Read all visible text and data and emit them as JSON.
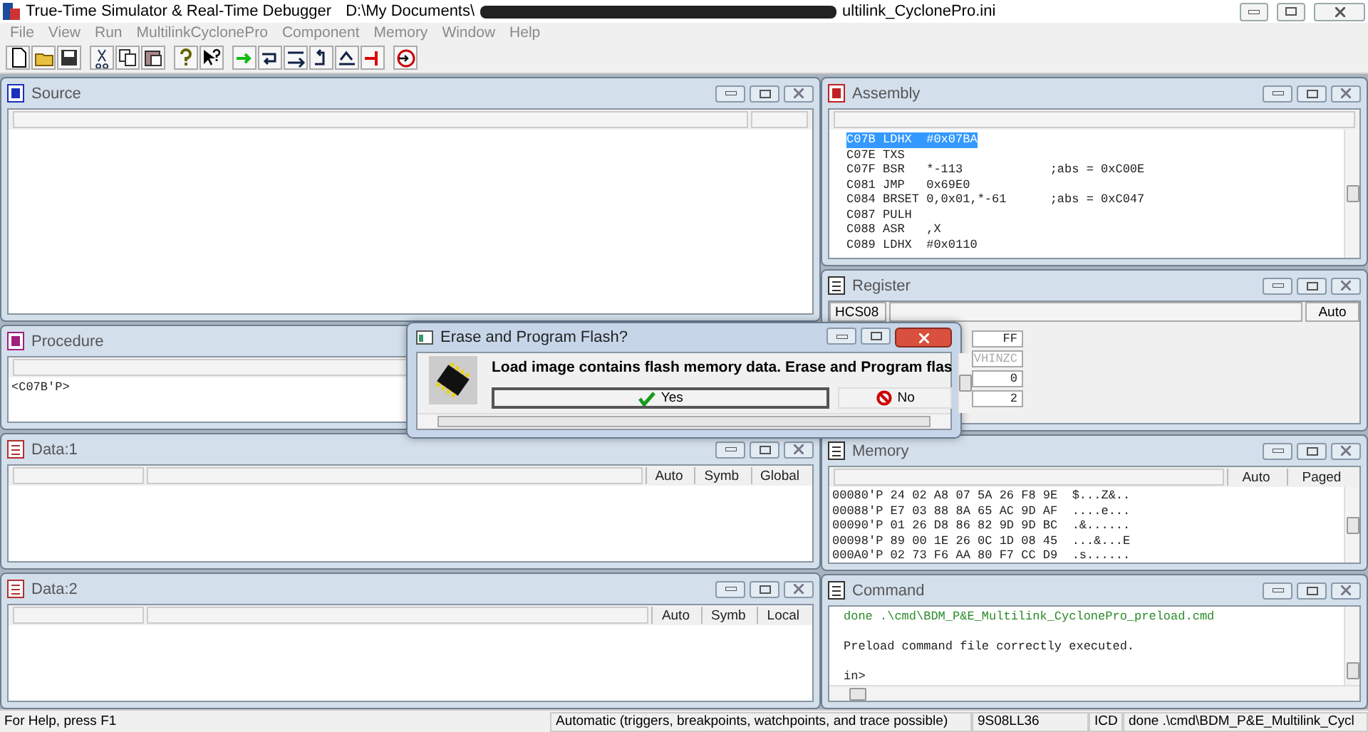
{
  "window": {
    "title": "True-Time Simulator & Real-Time Debugger",
    "path_start": "D:\\My Documents\\",
    "path_end": "ultilink_CyclonePro.ini"
  },
  "menu": [
    "File",
    "View",
    "Run",
    "MultilinkCyclonePro",
    "Component",
    "Memory",
    "Window",
    "Help"
  ],
  "left_panels": [
    {
      "kind": "source",
      "title": "Source"
    },
    {
      "kind": "procedure",
      "title": "Procedure",
      "lines": [
        "<C07B'P>"
      ]
    },
    {
      "kind": "data",
      "title": "Data:1",
      "headers": [
        "Auto",
        "Symb",
        "Global"
      ]
    },
    {
      "kind": "data",
      "title": "Data:2",
      "headers": [
        "Auto",
        "Symb",
        "Local"
      ]
    }
  ],
  "right_panels": [
    {
      "kind": "assembly",
      "title": "Assembly",
      "lines": [
        {
          "addr": "C07B",
          "op": "LDHX",
          "arg": "#0x07BA",
          "selected": true
        },
        {
          "addr": "C07E",
          "op": "TXS",
          "selected": false
        },
        {
          "addr": "C07F",
          "op": "BSR",
          "arg": "*-113",
          "comment": ";abs = 0xC00E",
          "selected": false
        },
        {
          "addr": "C081",
          "op": "JMP",
          "arg": "0x69E0",
          "selected": false
        },
        {
          "addr": "C084",
          "op": "BRSET",
          "arg": "0,0x01,*-61",
          "comment": ";abs = 0xC047",
          "selected": false
        },
        {
          "addr": "C087",
          "op": "PULH",
          "selected": false
        },
        {
          "addr": "C088",
          "op": "ASR",
          "arg": ",X",
          "selected": false
        },
        {
          "addr": "C089",
          "op": "LDHX",
          "arg": "#0x0110",
          "selected": false
        }
      ]
    },
    {
      "kind": "register",
      "title": "Register",
      "cpu": "HCS08",
      "mode": "Auto",
      "fields": [
        {
          "text": "FF",
          "disabled": false
        },
        {
          "text": "VHINZC",
          "disabled": true
        },
        {
          "text": "0",
          "disabled": false
        },
        {
          "text": "2",
          "disabled": false
        }
      ]
    },
    {
      "kind": "memory",
      "title": "Memory",
      "headers": [
        "Auto",
        "Paged"
      ],
      "rows": [
        {
          "addr": "00080'P",
          "bytes": "24 02 A8 07 5A 26 F8 9E",
          "ascii": "$...Z&.."
        },
        {
          "addr": "00088'P",
          "bytes": "E7 03 88 8A 65 AC 9D AF",
          "ascii": "....e..."
        },
        {
          "addr": "00090'P",
          "bytes": "01 26 D8 86 82 9D 9D BC",
          "ascii": ".&......"
        },
        {
          "addr": "00098'P",
          "bytes": "89 00 1E 26 0C 1D 08 45",
          "ascii": "...&...E"
        },
        {
          "addr": "000A0'P",
          "bytes": "02 73 F6 AA 80 F7 CC D9",
          "ascii": ".s......"
        }
      ]
    },
    {
      "kind": "command",
      "title": "Command",
      "lines": [
        {
          "kind": "echo",
          "text": "done .\\cmd\\BDM_P&E_Multilink_CyclonePro_preload.cmd"
        },
        {
          "kind": "blank"
        },
        {
          "kind": "output",
          "text": "Preload command file correctly executed."
        },
        {
          "kind": "blank"
        },
        {
          "kind": "output",
          "text": "in>"
        }
      ]
    }
  ],
  "dialog": {
    "title": "Erase and Program Flash?",
    "message": "Load image contains flash memory data. Erase and Program flas",
    "buttons": [
      {
        "kind": "yes",
        "label": "Yes",
        "default": true
      },
      {
        "kind": "no",
        "label": "No",
        "default": false
      }
    ]
  },
  "status_bar": [
    "For Help, press F1",
    "Automatic (triggers, breakpoints, watchpoints, and trace possible)",
    "9S08LL36",
    "ICD",
    "done .\\cmd\\BDM_P&E_Multilink_Cycl"
  ]
}
